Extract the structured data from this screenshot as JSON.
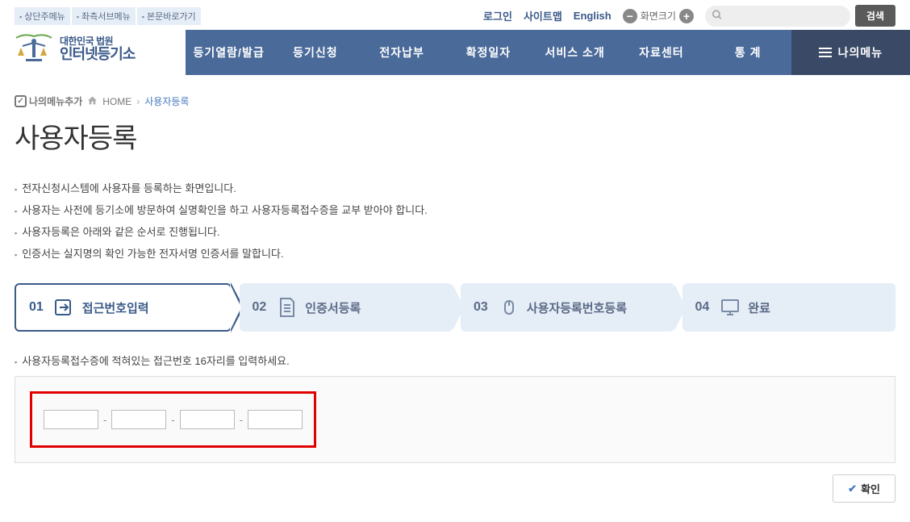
{
  "skip": [
    "상단주메뉴",
    "좌측서브메뉴",
    "본문바로가기"
  ],
  "util": {
    "login": "로그인",
    "sitemap": "사이트맵",
    "english": "English",
    "fontsize": "화면크기",
    "search_btn": "검색"
  },
  "logo": {
    "line1": "대한민국 법원",
    "line2": "인터넷등기소"
  },
  "nav": [
    "등기열람/발급",
    "등기신청",
    "전자납부",
    "확정일자",
    "서비스 소개",
    "자료센터",
    "통 계"
  ],
  "nav_mymenu": "나의메뉴",
  "breadcrumb": {
    "mymenu_add": "나의메뉴추가",
    "home": "HOME",
    "current": "사용자등록"
  },
  "page_title": "사용자등록",
  "intro": [
    "전자신청시스템에 사용자를 등록하는 화면입니다.",
    "사용자는 사전에 등기소에 방문하여 실명확인을 하고 사용자등록접수증을 교부 받아야 합니다.",
    "사용자등록은 아래와 같은 순서로 진행됩니다.",
    "인증서는 실지명의 확인 가능한 전자서명 인증서를 말합니다."
  ],
  "steps": [
    {
      "num": "01",
      "label": "접근번호입력"
    },
    {
      "num": "02",
      "label": "인증서등록"
    },
    {
      "num": "03",
      "label": "사용자등록번호등록"
    },
    {
      "num": "04",
      "label": "완료"
    }
  ],
  "instruction": "사용자등록접수증에 적혀있는 접근번호 16자리를 입력하세요.",
  "dash": "-",
  "confirm": "확인"
}
